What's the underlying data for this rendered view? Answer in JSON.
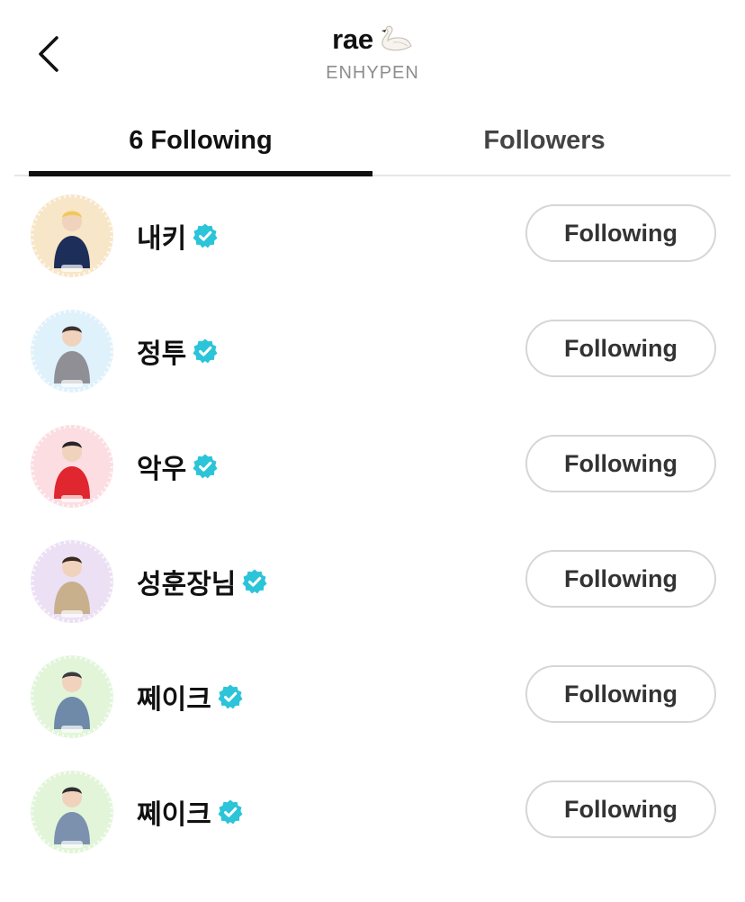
{
  "header": {
    "title": "rae",
    "subtitle": "ENHYPEN",
    "title_emoji_icon": "swan-icon",
    "back_icon": "chevron-left-icon"
  },
  "tabs": [
    {
      "label": "6 Following",
      "active": true
    },
    {
      "label": "Followers",
      "active": false
    }
  ],
  "colors": {
    "verified": "#2bc4d9",
    "button_border": "#d6d6d6",
    "tab_indicator": "#111111"
  },
  "users": [
    {
      "name": "내키",
      "verified": true,
      "button_label": "Following",
      "avatar_colors": [
        "#f7e6c8",
        "#1d2e5a",
        "#f0c95a"
      ]
    },
    {
      "name": "정투",
      "verified": true,
      "button_label": "Following",
      "avatar_colors": [
        "#dff1fb",
        "#8f8f95",
        "#3d3030"
      ]
    },
    {
      "name": "악우",
      "verified": true,
      "button_label": "Following",
      "avatar_colors": [
        "#fbdde2",
        "#e0262f",
        "#26262a"
      ]
    },
    {
      "name": "성훈장님",
      "verified": true,
      "button_label": "Following",
      "avatar_colors": [
        "#ece0f5",
        "#c8b08c",
        "#3a2a20"
      ]
    },
    {
      "name": "쩨이크",
      "verified": true,
      "button_label": "Following",
      "avatar_colors": [
        "#e2f5d9",
        "#6e8aa8",
        "#3b3b40"
      ]
    },
    {
      "name": "쩨이크",
      "verified": true,
      "button_label": "Following",
      "avatar_colors": [
        "#e2f5d9",
        "#7b91ad",
        "#2e2e33"
      ]
    }
  ]
}
